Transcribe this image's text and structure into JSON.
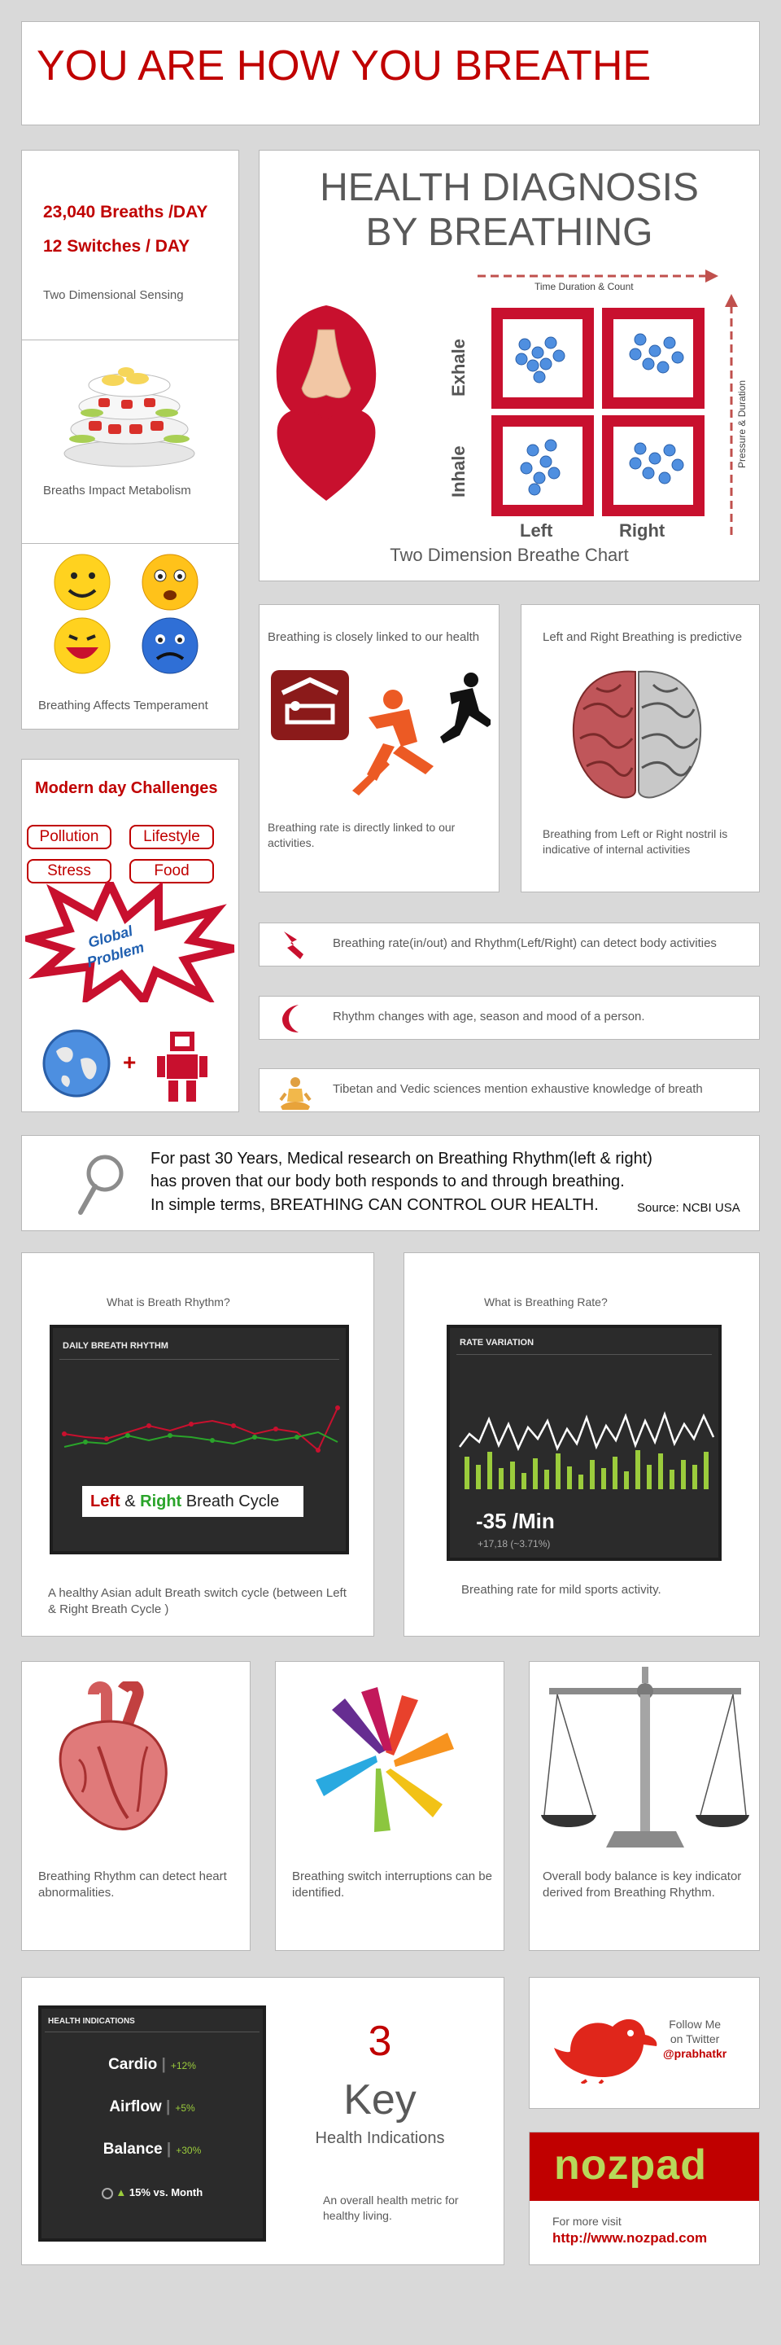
{
  "title": "YOU ARE HOW YOU BREATHE",
  "stats": {
    "breaths": "23,040 Breaths /DAY",
    "switches": "12 Switches / DAY",
    "sensing": "Two Dimensional Sensing",
    "metabolism": "Breaths Impact Metabolism",
    "temperament": "Breathing Affects Temperament"
  },
  "diagnosis": {
    "title_line1": "HEALTH DIAGNOSIS",
    "title_line2": "BY BREATHING",
    "time_axis": "Time Duration & Count",
    "pressure_axis": "Pressure & Duration",
    "exhale": "Exhale",
    "inhale": "Inhale",
    "left": "Left",
    "right": "Right",
    "caption": "Two Dimension Breathe Chart"
  },
  "linked": {
    "heading": "Breathing is closely linked to our health",
    "text": "Breathing rate is directly linked to our activities."
  },
  "predictive": {
    "heading": "Left and Right Breathing is predictive",
    "text": "Breathing from Left or Right nostril is indicative of internal activities"
  },
  "challenges": {
    "heading": "Modern day Challenges",
    "tags": [
      "Pollution",
      "Lifestyle",
      "Stress",
      "Food"
    ],
    "burst_line1": "Global",
    "burst_line2": "Problem"
  },
  "facts": [
    "Breathing rate(in/out) and Rhythm(Left/Right) can detect body activities",
    "Rhythm changes with age, season and mood of a person.",
    "Tibetan and Vedic sciences mention exhaustive knowledge of breath"
  ],
  "research": {
    "line1": "For past 30 Years, Medical research on Breathing Rhythm(left & right)",
    "line2": "has proven that our body both responds to and through breathing.",
    "line3": "In simple terms, BREATHING CAN CONTROL OUR HEALTH.",
    "source": "Source: NCBI USA"
  },
  "rhythm": {
    "question": "What is Breath Rhythm?",
    "panel_title": "DAILY BREATH RHYTHM",
    "legend_left": "Left",
    "legend_amp": " & ",
    "legend_right": "Right",
    "legend_rest": " Breath Cycle",
    "caption": "A healthy Asian adult Breath switch cycle (between Left & Right Breath Cycle  )"
  },
  "rate": {
    "question": "What is Breathing Rate?",
    "panel_title": "RATE VARIATION",
    "value": "-35 /Min",
    "delta": "+17,18 (~3.71%)",
    "caption": "Breathing rate for mild sports activity."
  },
  "detect": {
    "heart": "Breathing Rhythm can detect heart abnormalities.",
    "switch": "Breathing switch interruptions can be identified.",
    "balance": "Overall body balance is key indicator derived from Breathing Rhythm."
  },
  "indications": {
    "panel_title": "HEALTH INDICATIONS",
    "rows": [
      {
        "name": "Cardio",
        "delta": "+12%"
      },
      {
        "name": "Airflow",
        "delta": "+5%"
      },
      {
        "name": "Balance",
        "delta": "+30%"
      }
    ],
    "month": "15% vs. Month",
    "big_number": "3",
    "key": "Key",
    "sub": "Health Indications",
    "caption": "An overall health metric for healthy living."
  },
  "twitter": {
    "line1": "Follow Me",
    "line2": "on Twitter",
    "handle": "@prabhatkr"
  },
  "brand": {
    "logo": "nozpad",
    "visit": "For more visit",
    "url": "http://www.nozpad.com"
  },
  "colors": {
    "accent": "#c00000",
    "green": "#9bcc3c",
    "dot_blue": "#4f8fe0"
  }
}
